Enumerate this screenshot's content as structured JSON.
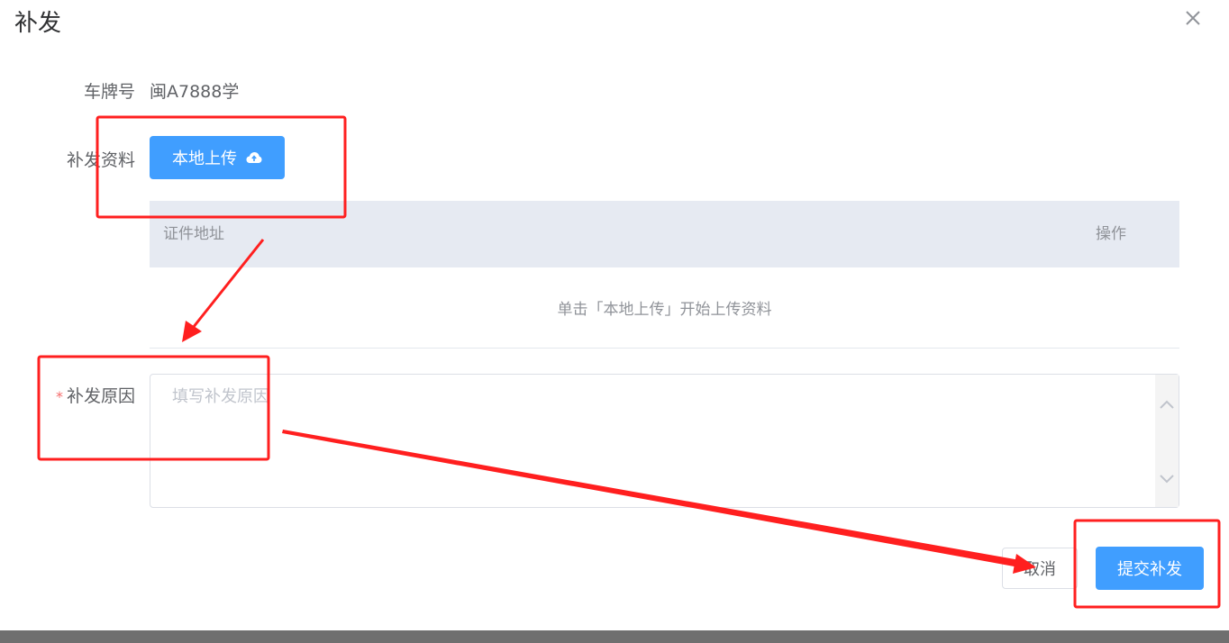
{
  "dialog": {
    "title": "补发"
  },
  "form": {
    "plate_label": "车牌号",
    "plate_value": "闽A7888学",
    "material_label": "补发资料",
    "upload_button": "本地上传",
    "reason_required_mark": "*",
    "reason_label": "补发原因",
    "reason_placeholder": "填写补发原因"
  },
  "table": {
    "columns": [
      "证件地址",
      "操作"
    ],
    "empty_text": "单击「本地上传」开始上传资料"
  },
  "footer": {
    "cancel_label": "取消",
    "submit_label": "提交补发"
  },
  "annotations": {
    "color": "#ff1f1f"
  },
  "icons": {
    "close": "close-icon",
    "upload": "cloud-upload-icon",
    "scroll_up": "chevron-up-icon",
    "scroll_down": "chevron-down-icon"
  },
  "colors": {
    "primary": "#409eff",
    "table_header_bg": "#e6eaf2",
    "required": "#f56c6c"
  }
}
